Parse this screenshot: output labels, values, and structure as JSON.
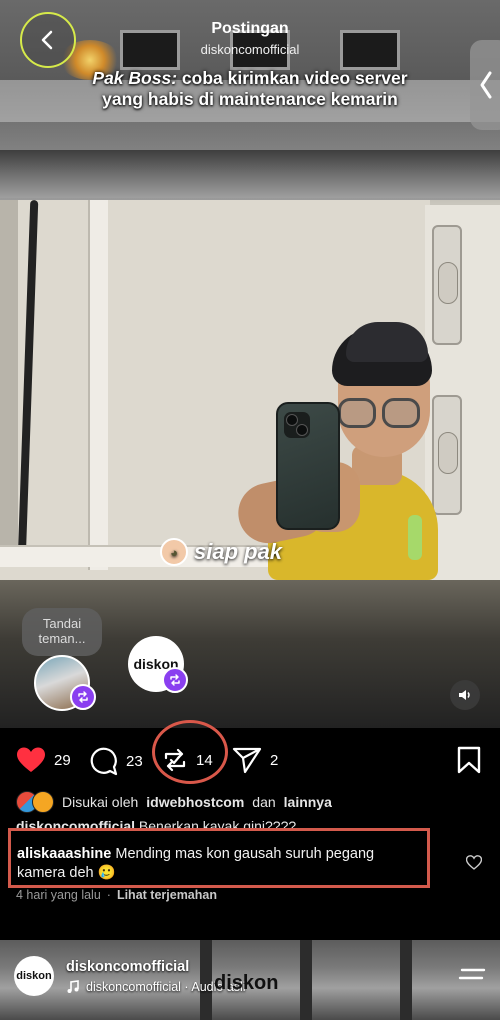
{
  "header": {
    "title": "Postingan",
    "username": "diskoncomofficial"
  },
  "caption": {
    "prefix": "Pak Boss:",
    "text": "coba kirimkan video server yang habis di maintenance kemarin"
  },
  "sticker": {
    "text": "siap pak"
  },
  "tag_bubble": {
    "text": "Tandai teman..."
  },
  "collab_avatar": {
    "logo_text": "diskon"
  },
  "actions": {
    "likes": "29",
    "comments": "23",
    "reposts": "14",
    "shares": "2"
  },
  "liked_by": {
    "prefix": "Disukai oleh",
    "user": "idwebhostcom",
    "connector": "dan",
    "others": "lainnya"
  },
  "post_caption": {
    "user": "diskoncomofficial",
    "text": "Benerkan kayak gini????"
  },
  "comment": {
    "user": "aliskaaashine",
    "text": "Mending mas kon gausah suruh pegang kamera deh 🥲"
  },
  "comment_meta": {
    "time": "4 hari yang lalu",
    "separator": "·",
    "translate": "Lihat terjemahan"
  },
  "next_post": {
    "username": "diskoncomofficial",
    "audio": "diskoncomofficial · Audio asli",
    "avatar_text": "diskon",
    "overlay_logo": "diskon"
  },
  "colors": {
    "accent_highlight": "#d35a4c",
    "like_red": "#ff3040",
    "repost_badge": "#8a3ff0",
    "back_ring": "#d6ea4a"
  },
  "icons": [
    "chevron-left-icon",
    "chevron-left-icon",
    "heart-icon",
    "comment-icon",
    "repost-icon",
    "send-icon",
    "bookmark-icon",
    "volume-icon",
    "music-icon",
    "menu-icon"
  ]
}
